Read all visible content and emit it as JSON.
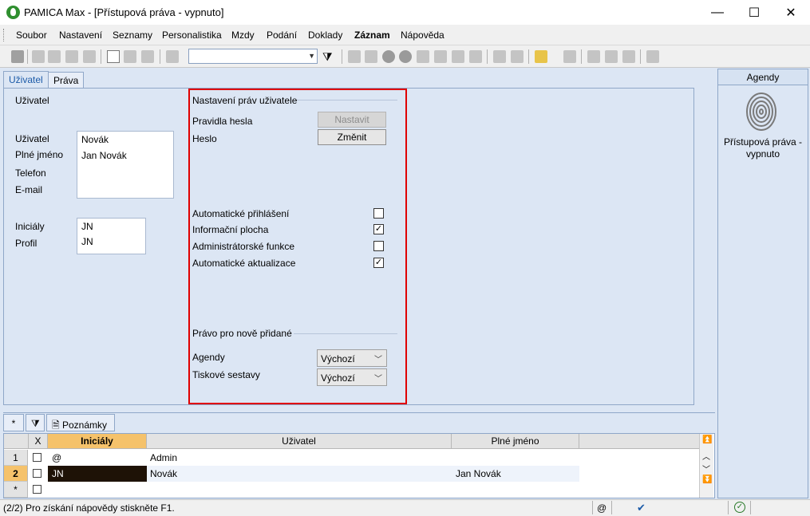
{
  "window": {
    "title": "PAMICA Max - [Přístupová práva - vypnuto]",
    "min": "—",
    "max": "☐",
    "close": "✕"
  },
  "menu": [
    "Soubor",
    "Nastavení",
    "Seznamy",
    "Personalistika",
    "Mzdy",
    "Podání",
    "Doklady",
    "Záznam",
    "Nápověda"
  ],
  "tabs": {
    "user": "Uživatel",
    "rights": "Práva"
  },
  "user_section": {
    "heading": "Uživatel",
    "labels": {
      "user": "Uživatel",
      "full_name": "Plné jméno",
      "phone": "Telefon",
      "email": "E-mail",
      "initials": "Iniciály",
      "profile": "Profil"
    },
    "values": {
      "user": "Novák",
      "full_name": "Jan Novák",
      "initials": "JN",
      "profile": "JN"
    }
  },
  "rights_section": {
    "heading": "Nastavení práv uživatele",
    "password_rules_label": "Pravidla hesla",
    "password_label": "Heslo",
    "set_button": "Nastavit",
    "change_button": "Změnit",
    "options": [
      {
        "label": "Automatické přihlášení",
        "checked": false
      },
      {
        "label": "Informační plocha",
        "checked": true
      },
      {
        "label": "Administrátorské funkce",
        "checked": false
      },
      {
        "label": "Automatické aktualizace",
        "checked": true
      }
    ],
    "new_rights_heading": "Právo pro nově přidané",
    "agendas_label": "Agendy",
    "agendas_value": "Výchozí",
    "reports_label": "Tiskové sestavy",
    "reports_value": "Výchozí"
  },
  "agendy_panel": {
    "header": "Agendy",
    "item_label": "Přístupová práva - vypnuto"
  },
  "grid": {
    "toolbar": {
      "star": "*",
      "notes_tab": "Poznámky"
    },
    "columns": {
      "x": "X",
      "initials": "Iniciály",
      "user": "Uživatel",
      "full_name": "Plné jméno"
    },
    "rows": [
      {
        "num": "1",
        "initials": "@",
        "user": "Admin",
        "full_name": ""
      },
      {
        "num": "2",
        "initials": "JN",
        "user": "Novák",
        "full_name": "Jan Novák"
      },
      {
        "num": "*",
        "initials": "",
        "user": "",
        "full_name": ""
      }
    ]
  },
  "status": {
    "text": "(2/2) Pro získání nápovědy stiskněte F1.",
    "at": "@"
  },
  "colors": {
    "highlight": "#e00000",
    "sorted_header": "#f5c26b",
    "selected_cell": "#1e1206"
  }
}
